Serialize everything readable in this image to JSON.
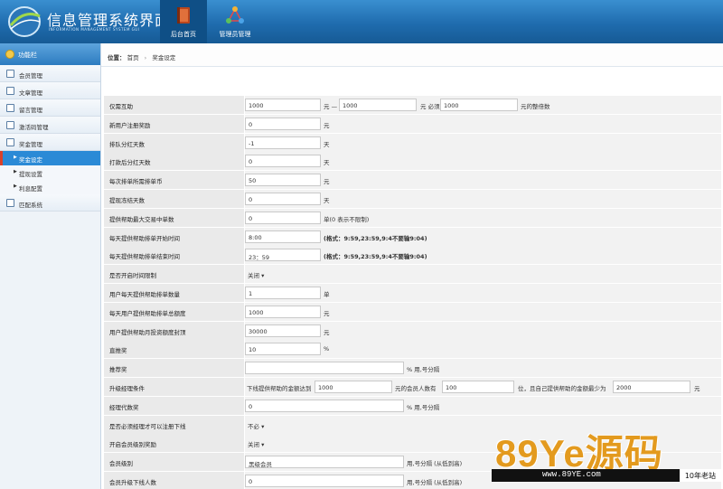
{
  "header": {
    "title": "信息管理系统界面",
    "subtitle": "INFORMATION MANAGEMENT SYSTEM GUI",
    "nav": [
      {
        "label": "后台首页",
        "icon": "book-icon"
      },
      {
        "label": "管理员管理",
        "icon": "network-icon"
      }
    ]
  },
  "sidebar": {
    "title": "功能栏",
    "items": [
      {
        "label": "会员管理"
      },
      {
        "label": "文章管理"
      },
      {
        "label": "留言管理"
      },
      {
        "label": "激活码管理"
      },
      {
        "label": "奖金管理"
      }
    ],
    "subitems": [
      {
        "label": "奖金设定"
      },
      {
        "label": "提现设置"
      },
      {
        "label": "利息配置"
      }
    ],
    "last_item": {
      "label": "匹配系统"
    }
  },
  "breadcrumb": {
    "prefix": "位置：",
    "home": "首页",
    "current": "奖金设定"
  },
  "form": {
    "rows": [
      {
        "label": "仅需互助",
        "v1": "1000",
        "t1": "元 —",
        "v2": "1000",
        "t2": "元 必须",
        "v3": "1000",
        "t3": "元的整倍数"
      },
      {
        "label": "新用户注册奖励",
        "value": "0",
        "unit": "元"
      },
      {
        "label": "排队分红天数",
        "value": "-1",
        "unit": "天"
      },
      {
        "label": "打款后分红天数",
        "value": "0",
        "unit": "天"
      },
      {
        "label": "每次排单所需排单币",
        "value": "50",
        "unit": "元"
      },
      {
        "label": "提现冻结天数",
        "value": "0",
        "unit": "天"
      },
      {
        "label": "提供帮助最大交易中单数",
        "value": "0",
        "unit": "单(0 表示不限制)"
      },
      {
        "label": "每天提供帮助排单开始时间",
        "value": "8:00",
        "unit": "(格式：9:59,23:59,9:4不要输9:04)"
      },
      {
        "label": "每天提供帮助排单结束时间",
        "value": "23：59",
        "unit": "(格式：9:59,23:59,9:4不要输9:04)"
      },
      {
        "label": "是否开启时间限制",
        "select": "关闭 ▾"
      },
      {
        "label": "用户每天提供帮助排单数量",
        "value": "1",
        "unit": "单"
      },
      {
        "label": "每天用户提供帮助排单总额度",
        "value": "1000",
        "unit": "元"
      },
      {
        "label": "用户提供帮助月投资额度封顶",
        "value": "30000",
        "unit": "元"
      },
      {
        "label": "直推奖",
        "value": "10",
        "unit": "%"
      },
      {
        "label": "推荐奖",
        "value": "",
        "unit": "% 用,号分隔"
      },
      {
        "label": "升级经理条件",
        "t0": "下线提供帮助的金额达到",
        "v1": "1000",
        "t1": "元的会员人数有",
        "v2": "100",
        "t2": "位，且自己提供帮助的金额最少为",
        "v3": "2000",
        "t3": "元"
      },
      {
        "label": "经理代数奖",
        "value": "0",
        "unit": "% 用,号分隔"
      },
      {
        "label": "是否必须经理才可以注册下线",
        "select": "不必 ▾"
      },
      {
        "label": "开启会员级别奖励",
        "select": "关闭 ▾"
      },
      {
        "label": "会员级别",
        "value": "黑级会员",
        "unit": "用,号分隔 (从低到高)"
      },
      {
        "label": "会员升级下线人数",
        "value": "0",
        "unit": "用,号分隔 (从低到高)"
      }
    ]
  },
  "watermark": {
    "brand": "89Ye源码",
    "url": "www.89YE.com",
    "tagline": "10年老站"
  }
}
